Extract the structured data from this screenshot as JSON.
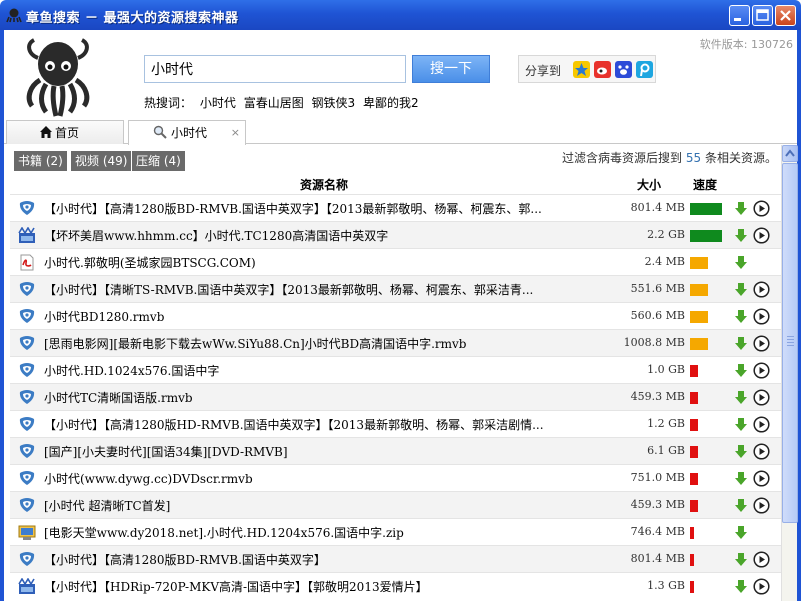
{
  "window": {
    "title": "章鱼搜索 － 最强大的资源搜索神器"
  },
  "header": {
    "version": "软件版本: 130726",
    "search_value": "小时代",
    "search_button": "搜一下",
    "share_label": "分享到",
    "share_icons": [
      "qzone-icon",
      "weibo-icon",
      "baidu-icon",
      "tencent-weibo-icon"
    ],
    "hot_label": "热搜词：",
    "hot_words": [
      "小时代",
      "富春山居图",
      "钢铁侠3",
      "卑鄙的我2"
    ]
  },
  "tabs": [
    {
      "label": "首页",
      "icon": "home-icon"
    },
    {
      "label": "小时代",
      "icon": "search-icon",
      "close": "×"
    }
  ],
  "filters": [
    {
      "label": "书籍 (2)"
    },
    {
      "label": "视频 (49)"
    },
    {
      "label": "压缩 (4)"
    }
  ],
  "summary": {
    "prefix": "过滤含病毒资源后搜到",
    "count": "55",
    "suffix": "条相关资源。"
  },
  "table": {
    "headers": {
      "name": "资源名称",
      "size": "大小",
      "speed": "速度"
    },
    "rows": [
      {
        "icon": "emule",
        "name": "【小时代】【高清1280版BD-RMVB.国语中英双字】【2013最新郭敬明、杨幂、柯震东、郭...",
        "size": "801.4 MB",
        "speed": "high",
        "play": true
      },
      {
        "icon": "video",
        "name": "【坏坏美眉www.hhmm.cc】小时代.TC1280高清国语中英双字",
        "size": "2.2 GB",
        "speed": "high",
        "play": true
      },
      {
        "icon": "pdf",
        "name": "小时代.郭敬明(圣城家园BTSCG.COM)",
        "size": "2.4 MB",
        "speed": "medium",
        "play": false
      },
      {
        "icon": "emule",
        "name": "【小时代】【清晰TS-RMVB.国语中英双字】【2013最新郭敬明、杨幂、柯震东、郭采洁青...",
        "size": "551.6 MB",
        "speed": "medium",
        "play": true
      },
      {
        "icon": "emule",
        "name": "小时代BD1280.rmvb",
        "size": "560.6 MB",
        "speed": "medium",
        "play": true
      },
      {
        "icon": "emule",
        "name": "[思雨电影网][最新电影下载去wWw.SiYu88.Cn]小时代BD高清国语中字.rmvb",
        "size": "1008.8 MB",
        "speed": "medium",
        "play": true
      },
      {
        "icon": "emule",
        "name": "小时代.HD.1024x576.国语中字",
        "size": "1.0 GB",
        "speed": "low",
        "play": true
      },
      {
        "icon": "emule",
        "name": "小时代TC清晰国语版.rmvb",
        "size": "459.3 MB",
        "speed": "low",
        "play": true
      },
      {
        "icon": "emule",
        "name": "【小时代】【高清1280版HD-RMVB.国语中英双字】【2013最新郭敬明、杨幂、郭采洁剧情...",
        "size": "1.2 GB",
        "speed": "low",
        "play": true
      },
      {
        "icon": "emule",
        "name": "[国产][小夫妻时代][国语34集][DVD-RMVB]",
        "size": "6.1 GB",
        "speed": "low",
        "play": true
      },
      {
        "icon": "emule",
        "name": "小时代(www.dywg.cc)DVDscr.rmvb",
        "size": "751.0 MB",
        "speed": "low",
        "play": true
      },
      {
        "icon": "emule",
        "name": "[小时代 超清晰TC首发]",
        "size": "459.3 MB",
        "speed": "low",
        "play": true
      },
      {
        "icon": "zip",
        "name": "[电影天堂www.dy2018.net].小时代.HD.1204x576.国语中字.zip",
        "size": "746.4 MB",
        "speed": "tiny",
        "play": false
      },
      {
        "icon": "emule",
        "name": "【小时代】【高清1280版BD-RMVB.国语中英双字】",
        "size": "801.4 MB",
        "speed": "tiny",
        "play": true
      },
      {
        "icon": "video",
        "name": "【小时代】【HDRip-720P-MKV高清-国语中字】【郭敬明2013爱情片】",
        "size": "1.3 GB",
        "speed": "tiny",
        "play": true
      }
    ]
  },
  "colors": {
    "speed_high": "#0f8a1e",
    "speed_medium": "#f5a800",
    "speed_low": "#e01010",
    "download_arrow": "#4aa52a",
    "titlebar": "#1f54d4"
  }
}
